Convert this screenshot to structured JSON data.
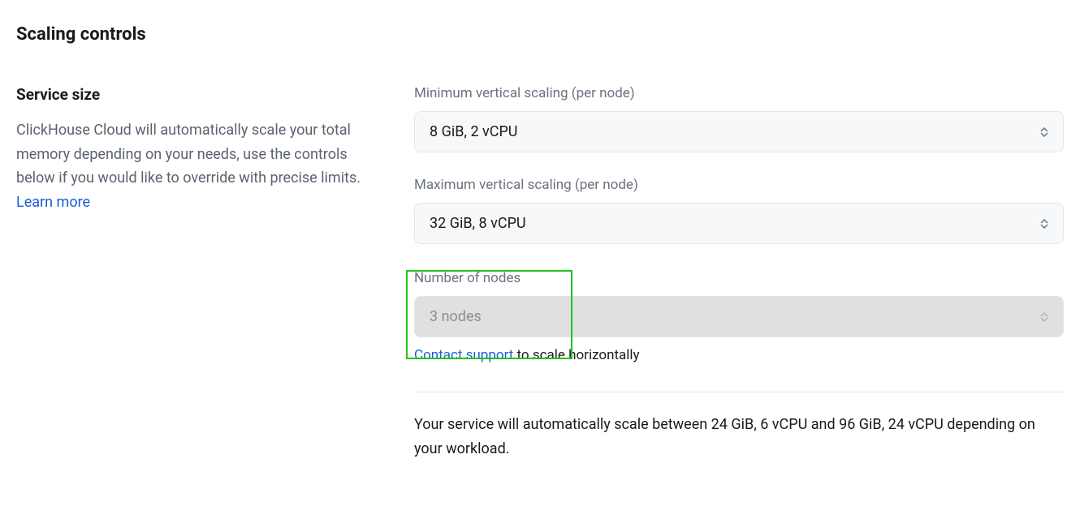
{
  "header": {
    "title": "Scaling controls"
  },
  "sidebar": {
    "section_title": "Service size",
    "description": "ClickHouse Cloud will automatically scale your total memory depending on your needs, use the controls below if you would like to override with precise limits.",
    "learn_more": "Learn more"
  },
  "fields": {
    "min_scaling": {
      "label": "Minimum vertical scaling (per node)",
      "value": "8 GiB, 2 vCPU"
    },
    "max_scaling": {
      "label": "Maximum vertical scaling (per node)",
      "value": "32 GiB, 8 vCPU"
    },
    "nodes": {
      "label": "Number of nodes",
      "value": "3 nodes",
      "contact_link": "Contact support",
      "hint_suffix": " to scale horizontally"
    }
  },
  "summary": {
    "text": "Your service will automatically scale between 24 GiB, 6 vCPU and 96 GiB, 24 vCPU depending on your workload."
  }
}
